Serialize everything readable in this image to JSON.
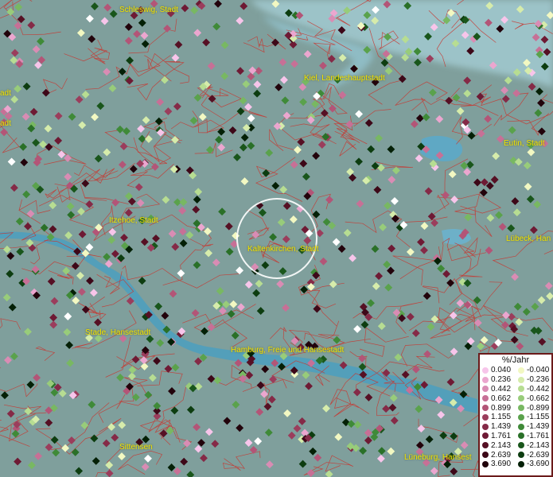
{
  "map": {
    "cities": [
      {
        "id": "schleswig",
        "label": "Schleswig, Stadt"
      },
      {
        "id": "kiel",
        "label": "Kiel, Landeshauptstadt"
      },
      {
        "id": "eutin",
        "label": "Eutin, Stadt"
      },
      {
        "id": "itzehoe",
        "label": "Itzehoe, Stadt"
      },
      {
        "id": "kaltenkirchen",
        "label": "Kaltenkirchen, Stadt"
      },
      {
        "id": "luebeck",
        "label": "Lübeck, Han"
      },
      {
        "id": "stade",
        "label": "Stade, Hansestadt"
      },
      {
        "id": "hamburg",
        "label": "Hamburg, Freie und Hansestadt"
      },
      {
        "id": "sittensen",
        "label": "Sittensen"
      },
      {
        "id": "lueneburg",
        "label": "Lüneburg, Hansest"
      },
      {
        "id": "left_edge_1",
        "label": "adt"
      },
      {
        "id": "left_edge_2",
        "label": "adt"
      }
    ],
    "colors": {
      "background": "#7f9f9c",
      "boundary": "#c8362f",
      "water": "#5fa8c4",
      "label": "#f2e200",
      "selection_ring": "#ffffff"
    }
  },
  "legend": {
    "title": "%/Jahr",
    "positive": [
      {
        "value": "0.040",
        "color": "#f7c5ea"
      },
      {
        "value": "0.236",
        "color": "#eba6cf"
      },
      {
        "value": "0.442",
        "color": "#d98cb4"
      },
      {
        "value": "0.662",
        "color": "#c77096"
      },
      {
        "value": "0.899",
        "color": "#b35577"
      },
      {
        "value": "1.155",
        "color": "#9b3d5c"
      },
      {
        "value": "1.439",
        "color": "#852a47"
      },
      {
        "value": "1.761",
        "color": "#6e1a34"
      },
      {
        "value": "2.143",
        "color": "#561024"
      },
      {
        "value": "2.639",
        "color": "#3d0818"
      },
      {
        "value": "3.690",
        "color": "#22030b"
      }
    ],
    "negative": [
      {
        "value": "-0.040",
        "color": "#f2f8c2"
      },
      {
        "value": "-0.236",
        "color": "#d6ecab"
      },
      {
        "value": "-0.442",
        "color": "#b7dd92"
      },
      {
        "value": "-0.662",
        "color": "#98cc7a"
      },
      {
        "value": "-0.899",
        "color": "#78b862"
      },
      {
        "value": "-1.155",
        "color": "#5aa24c"
      },
      {
        "value": "-1.439",
        "color": "#3f8a38"
      },
      {
        "value": "-1.761",
        "color": "#2a7028"
      },
      {
        "value": "-2.143",
        "color": "#19561b"
      },
      {
        "value": "-2.639",
        "color": "#0d3d10"
      },
      {
        "value": "-3.690",
        "color": "#042006"
      }
    ]
  }
}
